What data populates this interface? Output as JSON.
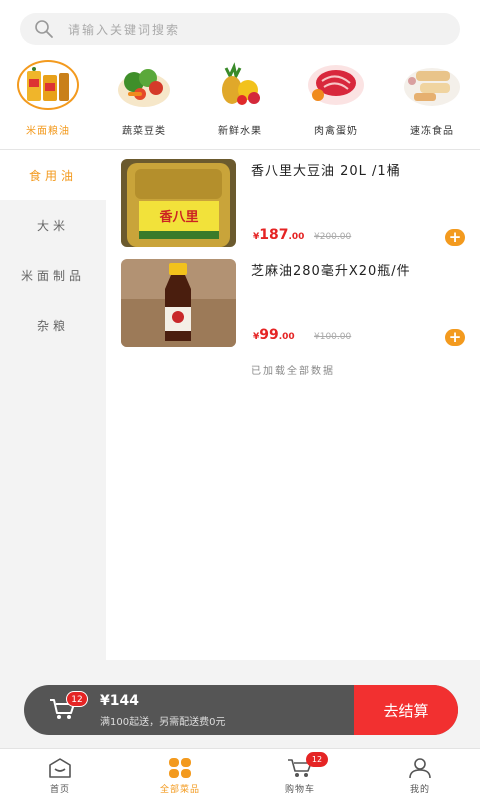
{
  "search": {
    "placeholder": "请输入关键词搜索"
  },
  "categories": [
    {
      "label": "米面粮油",
      "selected": true
    },
    {
      "label": "蔬菜豆类",
      "selected": false
    },
    {
      "label": "新鲜水果",
      "selected": false
    },
    {
      "label": "肉禽蛋奶",
      "selected": false
    },
    {
      "label": "速冻食品",
      "selected": false
    }
  ],
  "sidebar": {
    "items": [
      {
        "label": "食用油",
        "active": true
      },
      {
        "label": "大米",
        "active": false
      },
      {
        "label": "米面制品",
        "active": false
      },
      {
        "label": "杂粮",
        "active": false
      }
    ]
  },
  "products": [
    {
      "name": "香八里大豆油 20L /1桶",
      "price_symbol": "¥",
      "price_int": "187",
      "price_dec": ".00",
      "original_price": "¥200.00",
      "image_label": "香八里"
    },
    {
      "name": "芝麻油280毫升X20瓶/件",
      "price_symbol": "¥",
      "price_int": "99",
      "price_dec": ".00",
      "original_price": "¥100.00"
    }
  ],
  "list_status": "已加载全部数据",
  "cart": {
    "badge": "12",
    "total": "¥144",
    "note": "满100起送，另需配送费0元",
    "checkout_label": "去结算"
  },
  "tabbar": {
    "items": [
      {
        "label": "首页",
        "icon": "home-icon"
      },
      {
        "label": "全部菜品",
        "icon": "grid-icon",
        "active": true
      },
      {
        "label": "购物车",
        "icon": "cart-icon",
        "badge": "12"
      },
      {
        "label": "我的",
        "icon": "user-icon"
      }
    ]
  },
  "colors": {
    "accent": "#f39a1e",
    "price": "#e52424",
    "checkout": "#f23030",
    "cart_bar": "#555555"
  }
}
